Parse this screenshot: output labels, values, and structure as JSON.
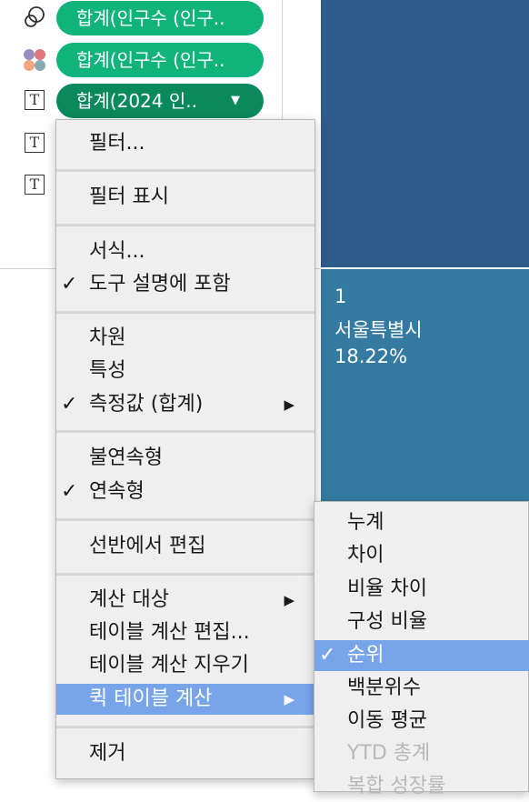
{
  "marks": [
    {
      "icon": "detail-icon",
      "label": "합계(인구수 (인구.."
    },
    {
      "icon": "color-icon",
      "label": "합계(인구수 (인구.."
    },
    {
      "icon": "text-icon",
      "label": "합계(2024 인.."
    }
  ],
  "viz": {
    "rank": "1",
    "region": "서울특별시",
    "percent": "18.22%"
  },
  "context_menu": {
    "items": [
      {
        "label": "필터..."
      },
      {
        "label": "필터 표시"
      },
      {
        "label": "서식..."
      },
      {
        "label": "도구 설명에 포함",
        "checked": true
      },
      {
        "label": "차원"
      },
      {
        "label": "특성"
      },
      {
        "label": "측정값 (합계)",
        "checked": true,
        "submenu": true
      },
      {
        "label": "불연속형"
      },
      {
        "label": "연속형",
        "checked": true
      },
      {
        "label": "선반에서 편집"
      },
      {
        "label": "계산 대상",
        "submenu": true
      },
      {
        "label": "테이블 계산 편집..."
      },
      {
        "label": "테이블 계산 지우기"
      },
      {
        "label": "퀵 테이블 계산",
        "submenu": true,
        "highlighted": true
      },
      {
        "label": "제거"
      }
    ]
  },
  "quick_table_submenu": {
    "items": [
      {
        "label": "누계"
      },
      {
        "label": "차이"
      },
      {
        "label": "비율 차이"
      },
      {
        "label": "구성 비율"
      },
      {
        "label": "순위",
        "checked": true,
        "highlighted": true
      },
      {
        "label": "백분위수"
      },
      {
        "label": "이동 평균"
      },
      {
        "label": "YTD 총계",
        "disabled": true
      },
      {
        "label": "복합 성장률",
        "disabled": true
      }
    ]
  },
  "colors": {
    "pill": "#10b37a",
    "viz_top": "#2d5b8a",
    "viz_bottom": "#347aa1",
    "menu_highlight": "#78a4ea"
  }
}
